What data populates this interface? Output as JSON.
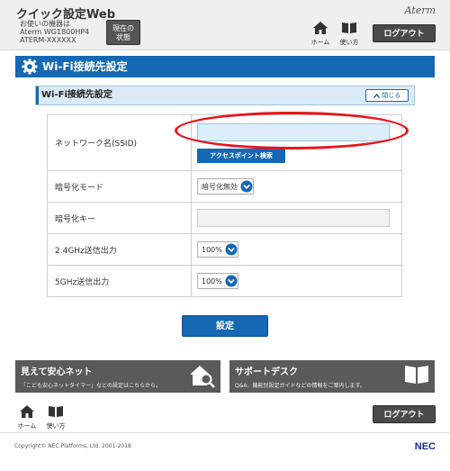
{
  "header": {
    "app_title": "クイック設定Web",
    "device_caption": "お使いの機器は",
    "device_model": "Aterm WG1800HP4",
    "device_name": "ATERM-XXXXXX",
    "current_status_label": "現在の\n状態",
    "brand": "Aterm",
    "home_label": "ホーム",
    "manual_label": "使い方",
    "logout_label": "ログアウト"
  },
  "page": {
    "title": "Wi-Fi接続先設定"
  },
  "section": {
    "title": "Wi-Fi接続先設定",
    "collapse_label": "閉じる"
  },
  "form": {
    "ssid": {
      "label": "ネットワーク名(SSID)",
      "value": "",
      "search_button": "アクセスポイント検索"
    },
    "encryption_mode": {
      "label": "暗号化モード",
      "selected": "暗号化無効"
    },
    "encryption_key": {
      "label": "暗号化キー",
      "value": ""
    },
    "power_24": {
      "label": "2.4GHz送信出力",
      "selected": "100%"
    },
    "power_5": {
      "label": "5GHz送信出力",
      "selected": "100%"
    }
  },
  "set_button": "設定",
  "cards": {
    "safe_net": {
      "title": "見えて安心ネット",
      "desc": "「こども安心ネットタイマー」などの設定はこちらから。"
    },
    "support": {
      "title": "サポートデスク",
      "desc": "Q&A、機能別設定ガイドなどの情報をご案内します。"
    }
  },
  "footer": {
    "home_label": "ホーム",
    "manual_label": "使い方",
    "logout_label": "ログアウト",
    "copyright": "Copyright© NEC Platforms, Ltd. 2001-2018",
    "nec": "NEC"
  },
  "colors": {
    "primary": "#1468b4",
    "highlight": "#e8141b",
    "dark_button": "#4a4a4a"
  }
}
